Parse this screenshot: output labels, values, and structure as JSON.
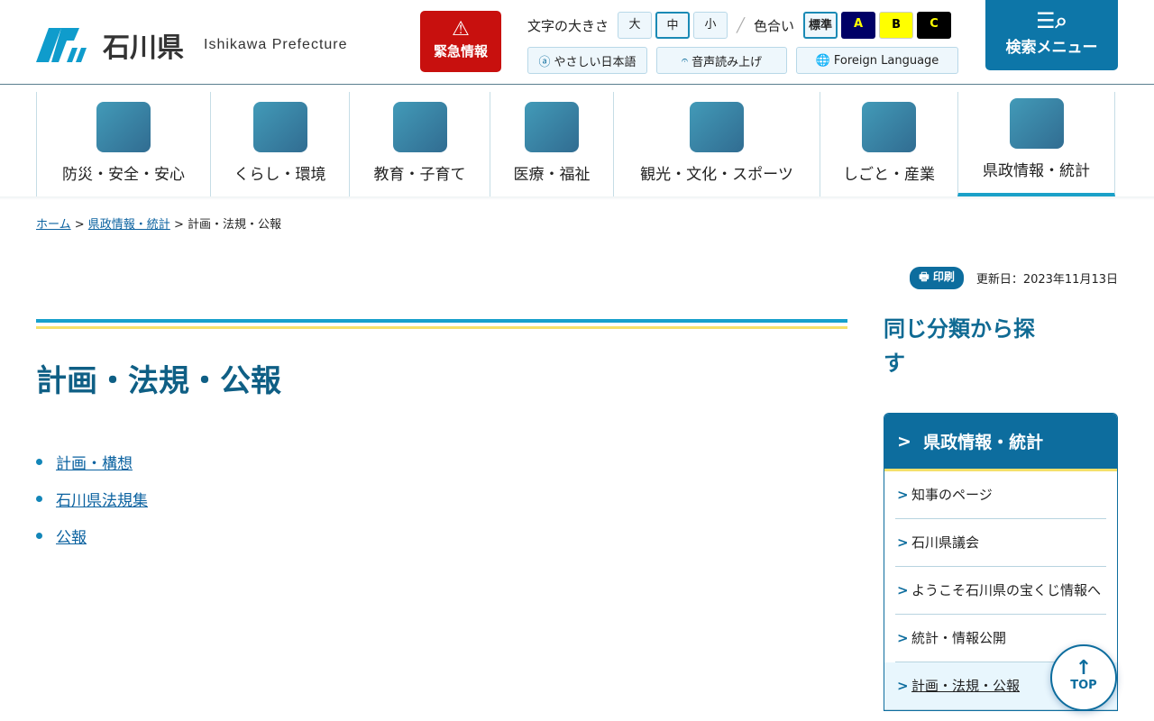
{
  "header": {
    "logo_jp": "石川県",
    "logo_en": "Ishikawa Prefecture",
    "emergency": "緊急情報",
    "font_size_label": "文字の大きさ",
    "font_sizes": [
      "大",
      "中",
      "小"
    ],
    "color_label": "色合い",
    "colors": [
      {
        "label": "標準",
        "bg": "#eef7fc",
        "fg": "#222"
      },
      {
        "label": "A",
        "bg": "#000066",
        "fg": "#ffff00"
      },
      {
        "label": "B",
        "bg": "#ffff00",
        "fg": "#000"
      },
      {
        "label": "C",
        "bg": "#000000",
        "fg": "#ffff00"
      }
    ],
    "easy_jp": "やさしい日本語",
    "voice": "音声読み上げ",
    "foreign": "Foreign Language",
    "search_menu": "検索メニュー"
  },
  "nav": [
    "防災・安全・安心",
    "くらし・環境",
    "教育・子育て",
    "医療・福祉",
    "観光・文化・スポーツ",
    "しごと・産業",
    "県政情報・統計"
  ],
  "breadcrumb": {
    "home": "ホーム",
    "parent": "県政情報・統計",
    "current": "計画・法規・公報"
  },
  "print": "印刷",
  "updated": "更新日：2023年11月13日",
  "main": {
    "title": "計画・法規・公報",
    "links": [
      "計画・構想",
      "石川県法規集",
      "公報"
    ]
  },
  "side": {
    "heading": "同じ分類から探す",
    "box_title": "県政情報・統計",
    "items": [
      "知事のページ",
      "石川県議会",
      "ようこそ石川県の宝くじ情報へ",
      "統計・情報公開",
      "計画・法規・公報"
    ]
  },
  "top": "TOP"
}
